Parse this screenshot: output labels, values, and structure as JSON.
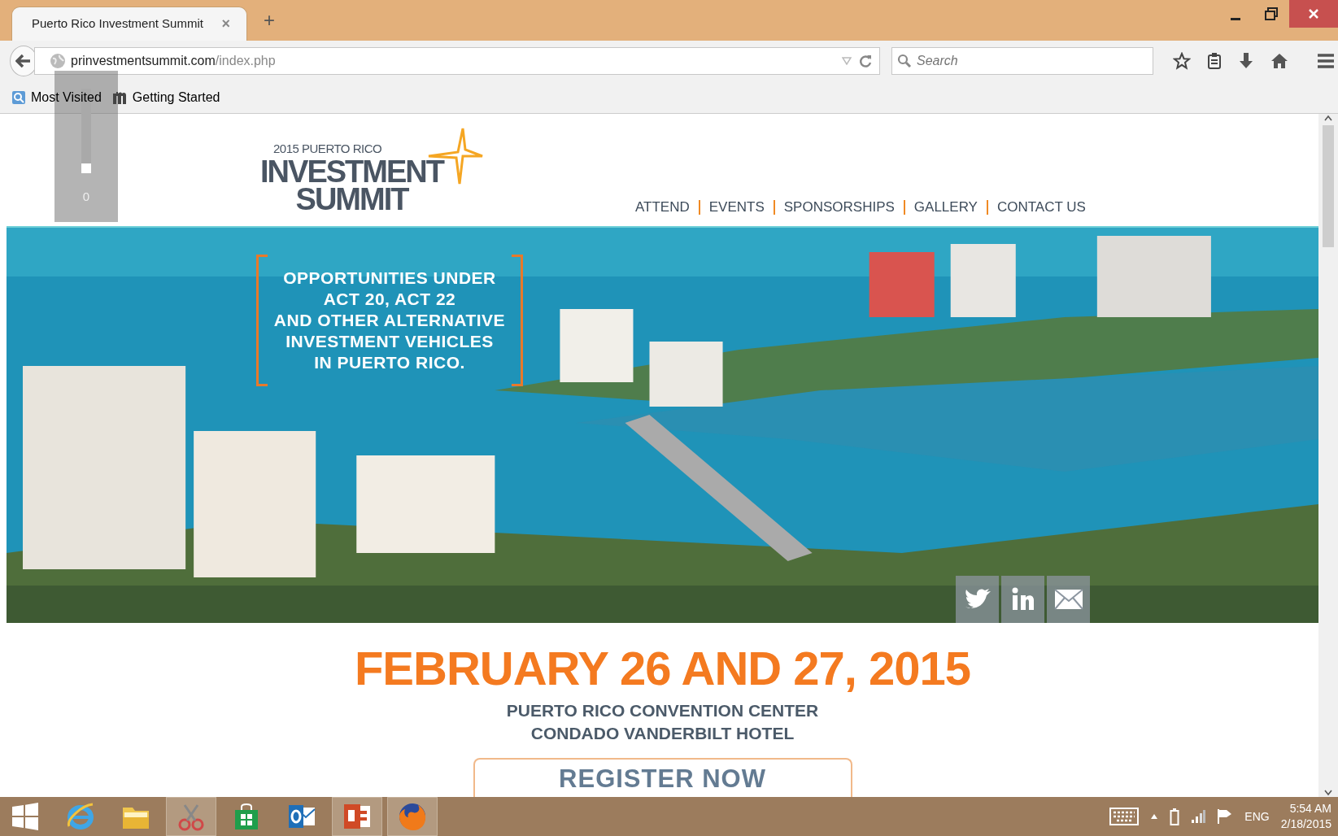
{
  "browser": {
    "tabs": [
      {
        "title": "Puerto Rico Investment Summit",
        "close": "×",
        "selected": true
      }
    ],
    "new_tab": "+",
    "address": {
      "domain": "prinvestmentsummit.com",
      "path": "/index.php"
    },
    "search": {
      "placeholder": "Search"
    },
    "bookmarks": [
      {
        "kind": "folder",
        "label": "Most Visited"
      },
      {
        "kind": "site",
        "label": "Getting Started"
      }
    ]
  },
  "volume_overlay": {
    "level": 0,
    "reading": "0"
  },
  "site": {
    "logo": {
      "year_line": "2015 PUERTO RICO",
      "title_lines": [
        "INVESTMENT",
        "SUMMIT"
      ]
    },
    "nav": [
      "ATTEND",
      "EVENTS",
      "SPONSORSHIPS",
      "GALLERY",
      "CONTACT US"
    ],
    "banner": {
      "kind": "picture",
      "headline": [
        "OPPORTUNITIES UNDER",
        "ACT 20, ACT 22",
        "AND OTHER ALTERNATIVE",
        "INVESTMENT VEHICLES",
        "IN PUERTO RICO."
      ],
      "social": [
        {
          "kind": "twitter"
        },
        {
          "kind": "linkedin"
        },
        {
          "kind": "email"
        }
      ]
    },
    "date": "FEBRUARY 26 AND 27, 2015",
    "venue": [
      "PUERTO RICO CONVENTION CENTER",
      "CONDADO VANDERBILT HOTEL"
    ],
    "register_button": "REGISTER NOW"
  },
  "taskbar": {
    "apps": [
      {
        "kind": "start",
        "running": false
      },
      {
        "kind": "ie",
        "running": false
      },
      {
        "kind": "folder",
        "running": false
      },
      {
        "kind": "snipping",
        "running": true
      },
      {
        "kind": "store",
        "running": false
      },
      {
        "kind": "mail",
        "running": false
      },
      {
        "kind": "slides",
        "running": true
      },
      {
        "kind": "firefox",
        "running": true
      }
    ],
    "language": "ENG",
    "time": "5:54 AM",
    "date": "2/18/2015"
  }
}
